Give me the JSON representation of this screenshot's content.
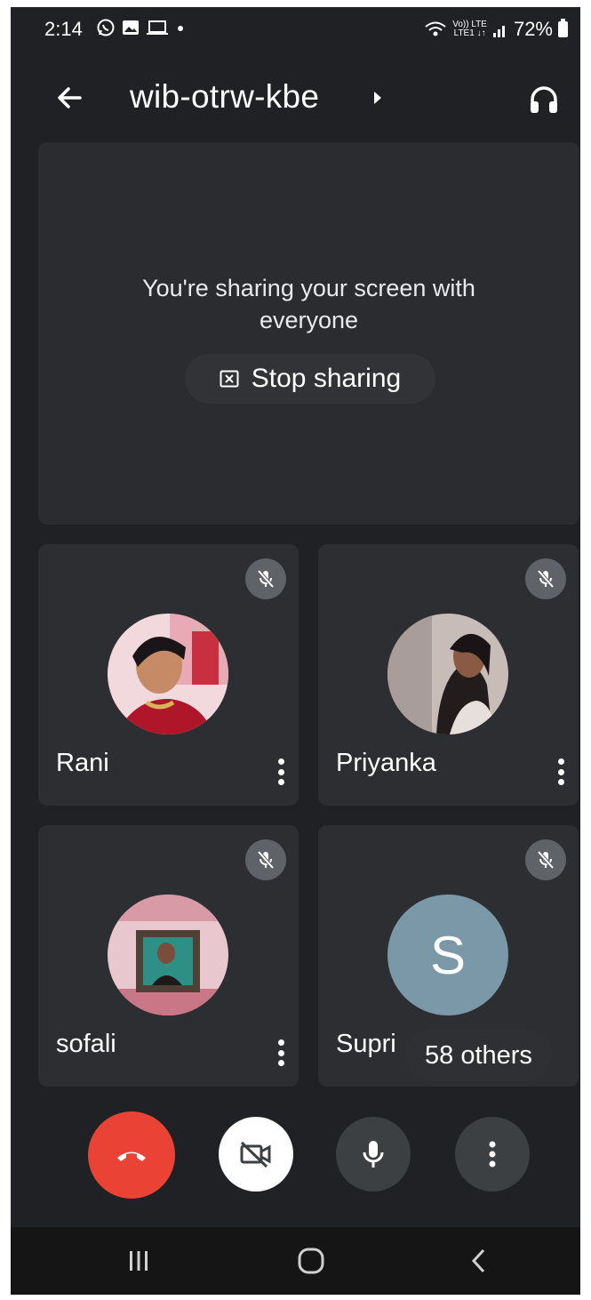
{
  "status_bar": {
    "time": "2:14",
    "battery": "72%",
    "network_label_top": "Vo)) LTE",
    "network_label_bottom": "LTE1 ↓↑"
  },
  "header": {
    "title": "wib-otrw-kbe",
    "back_icon": "arrow-back-icon",
    "audio_icon": "headset-icon"
  },
  "presentation": {
    "message_line1": "You're sharing your screen with",
    "message_line2": "everyone",
    "stop_label": "Stop sharing"
  },
  "participants": [
    {
      "name": "Rani",
      "muted": true,
      "avatar": "photo"
    },
    {
      "name": "Priyanka",
      "muted": true,
      "avatar": "photo"
    },
    {
      "name": "sofali",
      "muted": true,
      "avatar": "photo"
    },
    {
      "name": "Supri",
      "muted": true,
      "avatar": "letter",
      "letter": "S"
    }
  ],
  "others_label": "58 others",
  "controls": {
    "end_call": "phone-hangup-icon",
    "camera": "camera-off-icon",
    "mic": "mic-icon",
    "more": "more-vert-icon"
  },
  "colors": {
    "background": "#202124",
    "tile": "#2d2e31",
    "end_call": "#ea4335",
    "letter_avatar": "#7a98a8"
  }
}
